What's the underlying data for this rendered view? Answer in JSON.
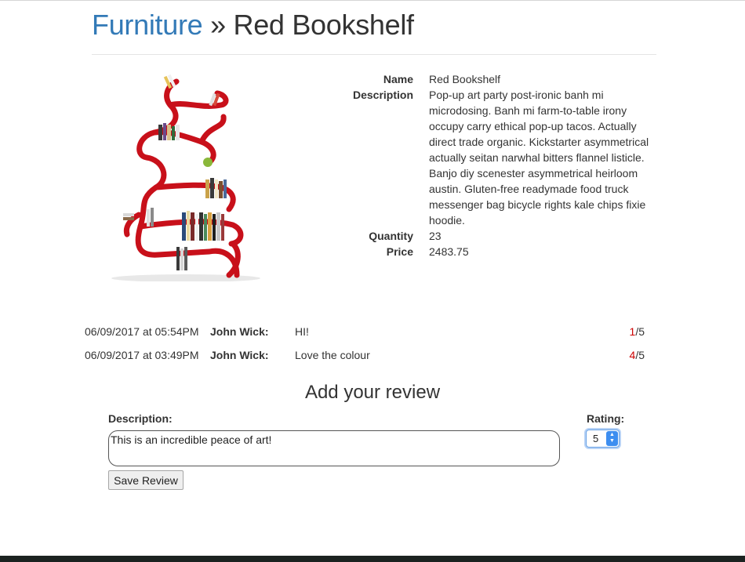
{
  "breadcrumb": {
    "category": "Furniture",
    "separator": "»",
    "current": "Red Bookshelf"
  },
  "product": {
    "image_alt": "red-bookshelf-photo",
    "fields": [
      {
        "label": "Name",
        "value": "Red Bookshelf"
      },
      {
        "label": "Description",
        "value": "Pop-up art party post-ironic banh mi microdosing. Banh mi farm-to-table irony occupy carry ethical pop-up tacos. Actually direct trade organic. Kickstarter asymmetrical actually seitan narwhal bitters flannel listicle. Banjo diy scenester asymmetrical heirloom austin. Gluten-free readymade food truck messenger bag bicycle rights kale chips fixie hoodie."
      },
      {
        "label": "Quantity",
        "value": "23"
      },
      {
        "label": "Price",
        "value": "2483.75"
      }
    ]
  },
  "reviews": [
    {
      "date": "06/09/2017 at 05:54PM",
      "user": "John Wick:",
      "text": "HI!",
      "score": "1",
      "max": "/5"
    },
    {
      "date": "06/09/2017 at 03:49PM",
      "user": "John Wick:",
      "text": "Love the colour",
      "score": "4",
      "max": "/5"
    }
  ],
  "review_form": {
    "heading": "Add your review",
    "description_label": "Description:",
    "description_value": "This is an incredible peace of art!",
    "rating_label": "Rating:",
    "rating_value": "5",
    "submit_label": "Save Review"
  },
  "colors": {
    "link": "#337ab7",
    "score": "#cc0000",
    "shelf": "#c8101a"
  }
}
